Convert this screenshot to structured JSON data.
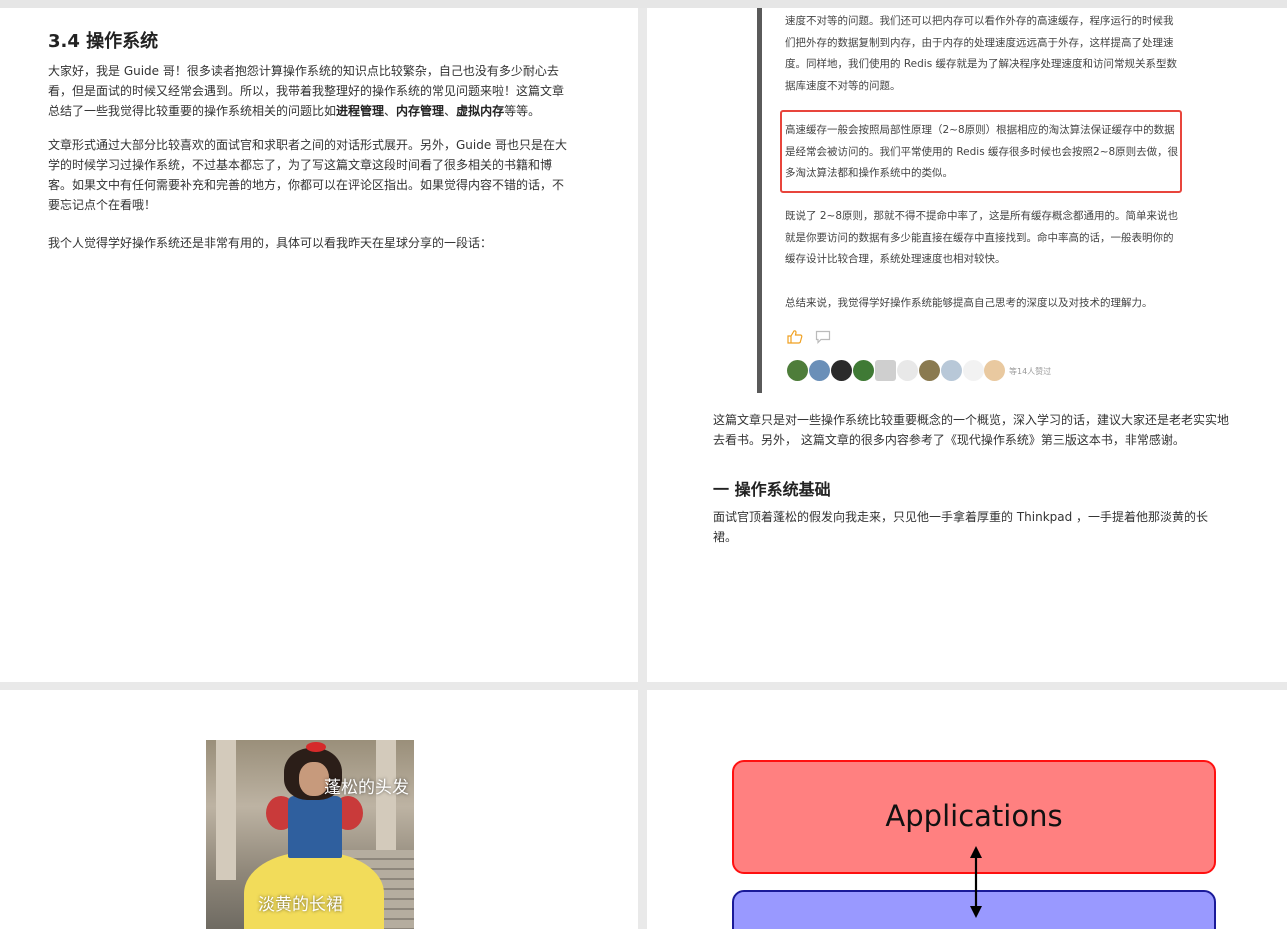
{
  "page1": {
    "heading": "3.4 操作系统",
    "intro": {
      "a": "大家好，我是 Guide 哥！很多读者抱怨计算操作系统的知识点比较繁杂，自己也没有多少耐心去看，但是面试的时候又经常会遇到。所以，我带着我整理好的操作系统的常见问题来啦！这篇文章总结了一些我觉得比较重要的操作系统相关的问题比如",
      "b1": "进程管理",
      "s1": "、",
      "b2": "内存管理",
      "s2": "、",
      "b3": "虚拟内存",
      "c": "等等。"
    },
    "para2": "文章形式通过大部分比较喜欢的面试官和求职者之间的对话形式展开。另外，Guide 哥也只是在大学的时候学习过操作系统，不过基本都忘了，为了写这篇文章这段时间看了很多相关的书籍和博客。如果文中有任何需要补充和完善的地方，你都可以在评论区指出。如果觉得内容不错的话，不要忘记点个在看哦！",
    "para3": "我个人觉得学好操作系统还是非常有用的，具体可以看我昨天在星球分享的一段话："
  },
  "page2": {
    "quote": {
      "p1": "速度不对等的问题。我们还可以把内存可以看作外存的高速缓存，程序运行的时候我们把外存的数据复制到内存，由于内存的处理速度远远高于外存，这样提高了处理速度。同样地，我们使用的 Redis 缓存就是为了解决程序处理速度和访问常规关系型数据库速度不对等的问题。",
      "p2": "高速缓存一般会按照局部性原理（2~8原则）根据相应的淘汰算法保证缓存中的数据是经常会被访问的。我们平常使用的 Redis 缓存很多时候也会按照2~8原则去做，很多淘汰算法都和操作系统中的类似。",
      "p3": "既说了 2~8原则，那就不得不提命中率了，这是所有缓存概念都通用的。简单来说也就是你要访问的数据有多少能直接在缓存中直接找到。命中率高的话，一般表明你的缓存设计比较合理，系统处理速度也相对较快。",
      "p4": "总结来说，我觉得学好操作系统能够提高自己思考的深度以及对技术的理解力。",
      "likes_text": "等14人赞过",
      "accent": "#e8453c"
    },
    "after": "这篇文章只是对一些操作系统比较重要概念的一个概览，深入学习的话，建议大家还是老老实实地去看书。另外， 这篇文章的很多内容参考了《现代操作系统》第三版这本书，非常感谢。",
    "heading": "一 操作系统基础",
    "story": "面试官顶着蓬松的假发向我走来，只见他一手拿着厚重的 Thinkpad ，一手提着他那淡黄的长裙。"
  },
  "page3": {
    "caption_top": "蓬松的头发",
    "caption_bottom": "淡黄的长裙"
  },
  "page4": {
    "box_top": "Applications",
    "box_top_color": "#ff8080",
    "box_bottom_color": "#9999ff"
  }
}
